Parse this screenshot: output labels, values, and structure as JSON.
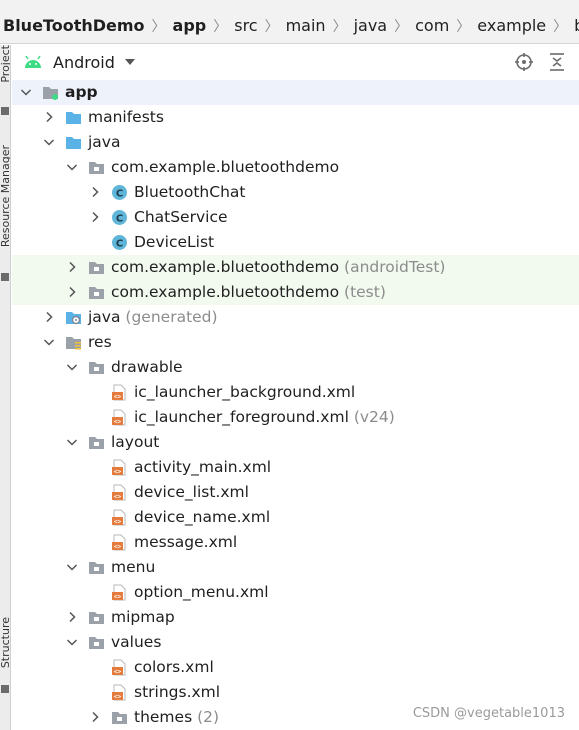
{
  "breadcrumb": [
    "BlueToothDemo",
    "app",
    "src",
    "main",
    "java",
    "com",
    "example",
    "bluetoothdem"
  ],
  "side_tabs": [
    "Project",
    "Resource Manager",
    "Structure"
  ],
  "panel": {
    "view_label": "Android"
  },
  "tree": [
    {
      "label": "app",
      "suffix": "",
      "level": 0,
      "arrow": "down",
      "icon": "module-folder-icon",
      "bold": true,
      "hl": "sel"
    },
    {
      "label": "manifests",
      "suffix": "",
      "level": 1,
      "arrow": "right",
      "icon": "folder-icon"
    },
    {
      "label": "java",
      "suffix": "",
      "level": 1,
      "arrow": "down",
      "icon": "folder-icon"
    },
    {
      "label": "com.example.bluetoothdemo",
      "suffix": "",
      "level": 2,
      "arrow": "down",
      "icon": "package-icon"
    },
    {
      "label": "BluetoothChat",
      "suffix": "",
      "level": 3,
      "arrow": "right",
      "icon": "class-icon"
    },
    {
      "label": "ChatService",
      "suffix": "",
      "level": 3,
      "arrow": "right",
      "icon": "class-icon"
    },
    {
      "label": "DeviceList",
      "suffix": "",
      "level": 3,
      "arrow": "none",
      "icon": "class-icon"
    },
    {
      "label": "com.example.bluetoothdemo",
      "suffix": " (androidTest)",
      "level": 2,
      "arrow": "right",
      "icon": "package-icon",
      "hl": "test"
    },
    {
      "label": "com.example.bluetoothdemo",
      "suffix": " (test)",
      "level": 2,
      "arrow": "right",
      "icon": "package-icon",
      "hl": "test"
    },
    {
      "label": "java",
      "suffix": " (generated)",
      "level": 1,
      "arrow": "right",
      "icon": "generated-folder-icon"
    },
    {
      "label": "res",
      "suffix": "",
      "level": 1,
      "arrow": "down",
      "icon": "res-folder-icon"
    },
    {
      "label": "drawable",
      "suffix": "",
      "level": 2,
      "arrow": "down",
      "icon": "package-icon"
    },
    {
      "label": "ic_launcher_background.xml",
      "suffix": "",
      "level": 3,
      "arrow": "none",
      "icon": "xml-file-icon"
    },
    {
      "label": "ic_launcher_foreground.xml",
      "suffix": " (v24)",
      "level": 3,
      "arrow": "none",
      "icon": "xml-file-icon"
    },
    {
      "label": "layout",
      "suffix": "",
      "level": 2,
      "arrow": "down",
      "icon": "package-icon"
    },
    {
      "label": "activity_main.xml",
      "suffix": "",
      "level": 3,
      "arrow": "none",
      "icon": "xml-file-icon"
    },
    {
      "label": "device_list.xml",
      "suffix": "",
      "level": 3,
      "arrow": "none",
      "icon": "xml-file-icon"
    },
    {
      "label": "device_name.xml",
      "suffix": "",
      "level": 3,
      "arrow": "none",
      "icon": "xml-file-icon"
    },
    {
      "label": "message.xml",
      "suffix": "",
      "level": 3,
      "arrow": "none",
      "icon": "xml-file-icon"
    },
    {
      "label": "menu",
      "suffix": "",
      "level": 2,
      "arrow": "down",
      "icon": "package-icon"
    },
    {
      "label": "option_menu.xml",
      "suffix": "",
      "level": 3,
      "arrow": "none",
      "icon": "xml-file-icon"
    },
    {
      "label": "mipmap",
      "suffix": "",
      "level": 2,
      "arrow": "right",
      "icon": "package-icon"
    },
    {
      "label": "values",
      "suffix": "",
      "level": 2,
      "arrow": "down",
      "icon": "package-icon"
    },
    {
      "label": "colors.xml",
      "suffix": "",
      "level": 3,
      "arrow": "none",
      "icon": "xml-file-icon"
    },
    {
      "label": "strings.xml",
      "suffix": "",
      "level": 3,
      "arrow": "none",
      "icon": "xml-file-icon"
    },
    {
      "label": "themes",
      "suffix": " (2)",
      "level": 3,
      "arrow": "right",
      "icon": "package-icon"
    }
  ],
  "watermark": "CSDN @vegetable1013",
  "colors": {
    "folder": "#5ab2e6",
    "package": "#9aa1a8",
    "class": "#5fb6d8",
    "xml": "#e57c3d",
    "android": "#3ddc84"
  }
}
